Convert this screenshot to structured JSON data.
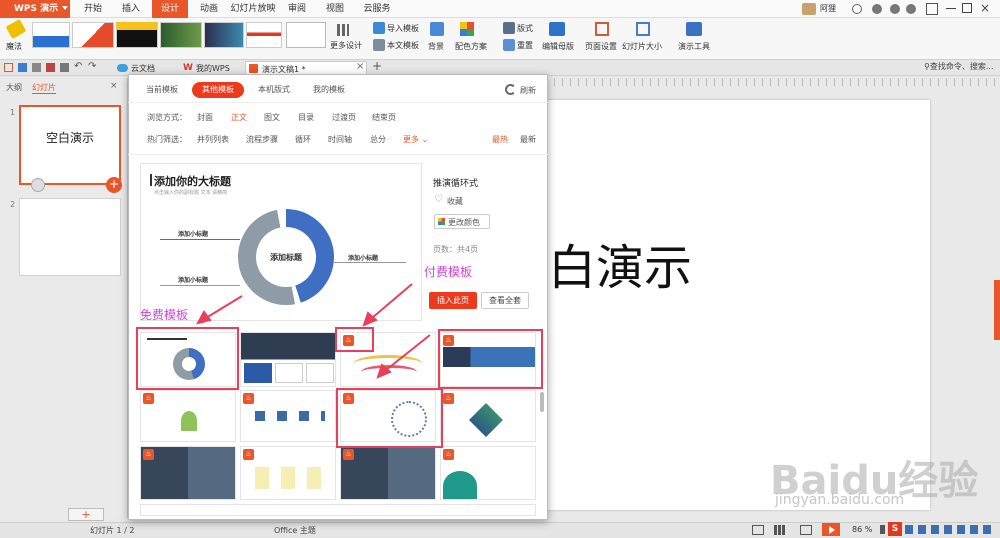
{
  "app": {
    "logo": "WPS 演示",
    "window_user": "阿狸"
  },
  "menu_tabs": [
    "开始",
    "插入",
    "设计",
    "动画",
    "幻灯片放映",
    "审阅",
    "视图",
    "云服务"
  ],
  "ribbon": {
    "magic": "魔法",
    "more_design": "更多设计",
    "import_template": "导入模板",
    "text_template": "本文模板",
    "background": "背景",
    "color_scheme": "配色方案",
    "layout": "版式",
    "reset": "重置",
    "edit_master": "编辑母版",
    "page_setup": "页面设置",
    "slide_size": "幻灯片大小",
    "presentation_tools": "演示工具"
  },
  "doc_tabs": {
    "cloud": "云文档",
    "mywps": "我的WPS",
    "current": "演示文稿1 *",
    "search": "查找命令、搜索..."
  },
  "left_pane": {
    "outline": "大纲",
    "slides": "幻灯片",
    "slide1_text": "空白演示",
    "slide1_num": "1",
    "slide2_num": "2"
  },
  "canvas_text": "白演示",
  "dialog": {
    "tabs": [
      "当前模板",
      "其他模板",
      "本机版式",
      "我的模板"
    ],
    "refresh": "刷新",
    "browse_label": "浏览方式：",
    "browse_items": [
      "封面",
      "正文",
      "图文",
      "目录",
      "过渡页",
      "结束页"
    ],
    "hot_label": "热门筛选：",
    "hot_items": [
      "并列列表",
      "流程步骤",
      "循环",
      "时间轴",
      "总分"
    ],
    "more": "更多",
    "sort_hot": "最热",
    "sort_new": "最新",
    "preview": {
      "title": "添加你的大标题",
      "subtitle": "点击输入你的副标题 文本 请精简",
      "center": "添加标题",
      "small1": "添加小标题",
      "small2": "添加小标题",
      "small3": "添加小标题"
    },
    "side": {
      "name": "推演循环式",
      "fav": "收藏",
      "change_color": "更改颜色",
      "pages": "页数：共4页",
      "insert": "插入此页",
      "view_all": "查看全套"
    }
  },
  "annotations": {
    "free": "免费模板",
    "paid": "付费模板"
  },
  "status": {
    "slide_info": "幻灯片 1 / 2",
    "theme": "Office 主题",
    "zoom": "86 %"
  },
  "colors": {
    "accent": "#e8562a",
    "tab_red": "#ee3a1c",
    "ann_pink": "#d63fe0",
    "box_red": "#e8405a",
    "ring_blue": "#3f6fc3",
    "ring_grey": "#8f9ca8"
  }
}
